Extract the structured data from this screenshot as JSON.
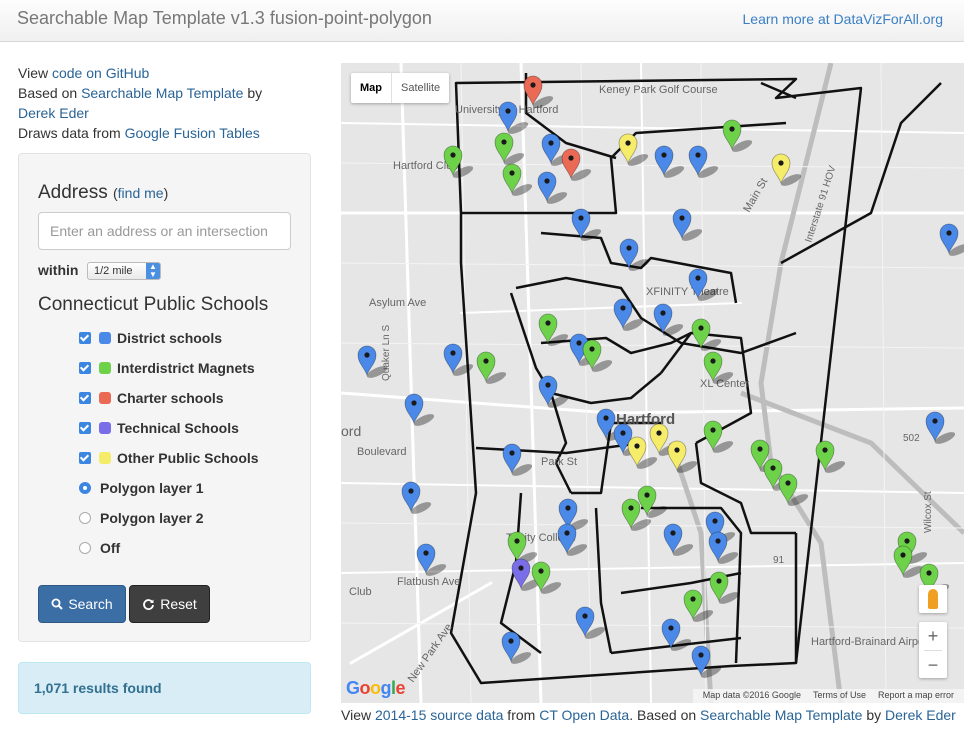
{
  "navbar": {
    "title": "Searchable Map Template v1.3 fusion-point-polygon",
    "learn_more": "Learn more at DataVizForAll.org"
  },
  "intro": {
    "view_prefix": "View ",
    "github_link": "code on GitHub",
    "based_prefix": "Based on ",
    "template_link": "Searchable Map Template",
    "based_by": " by",
    "author_link": "Derek Eder",
    "draws_prefix": "Draws data from ",
    "fusion_link": "Google Fusion Tables"
  },
  "search": {
    "address_heading": "Address",
    "find_me_open": "(",
    "find_me": "find me",
    "find_me_close": ")",
    "address_placeholder": "Enter an address or an intersection",
    "within_label": "within",
    "within_value": "1/2 mile",
    "schools_heading": "Connecticut Public Schools"
  },
  "layers": [
    {
      "label": "District schools",
      "color": "#4a89e8",
      "checked": true
    },
    {
      "label": "Interdistrict Magnets",
      "color": "#6dd24a",
      "checked": true
    },
    {
      "label": "Charter schools",
      "color": "#ea6a56",
      "checked": true
    },
    {
      "label": "Technical Schools",
      "color": "#7a6ee8",
      "checked": true
    },
    {
      "label": "Other Public Schools",
      "color": "#f5ec6a",
      "checked": true
    }
  ],
  "polygon_options": [
    {
      "label": "Polygon layer 1",
      "selected": true
    },
    {
      "label": "Polygon layer 2",
      "selected": false
    },
    {
      "label": "Off",
      "selected": false
    }
  ],
  "buttons": {
    "search_label": "Search",
    "reset_label": "Reset"
  },
  "results": {
    "text": "1,071 results found"
  },
  "map": {
    "type_map": "Map",
    "type_satellite": "Satellite",
    "labels": {
      "hartford": "Hartford",
      "xl_center": "XL Center",
      "xfinity": "XFINITY Theatre",
      "trinity": "Trinity College",
      "golf": "Keney Park Golf Course",
      "airport": "Hartford-Brainard Airport",
      "asylum": "Asylum Ave",
      "park": "Park St",
      "boulevard": "Boulevard",
      "flatbush": "Flatbush Ave",
      "new_park": "New Park Ave",
      "main": "Main St",
      "interstate": "Interstate 91 HOV",
      "univ": "University of Hartford",
      "ord": "ord",
      "club": "Club",
      "hclub": "Hartford Club",
      "r91": "91",
      "r502": "502",
      "wilcox": "Wilcox St",
      "quaker": "Quaker Ln S"
    },
    "zoom_in": "+",
    "zoom_out": "−",
    "google": "Google",
    "attribution": {
      "data": "Map data ©2016 Google",
      "terms": "Terms of Use",
      "report": "Report a map error"
    }
  },
  "footer": {
    "view_prefix": "View ",
    "source_link": "2014-15 source data",
    "from_text": " from ",
    "ct_link": "CT Open Data",
    "based_text": ". Based on ",
    "template_link": "Searchable Map Template",
    "by_text": " by ",
    "author_link": "Derek Eder"
  },
  "colors": {
    "district": "#4a89e8",
    "magnet": "#6dd24a",
    "charter": "#ea6a56",
    "technical": "#7a6ee8",
    "other": "#f5ec6a"
  }
}
